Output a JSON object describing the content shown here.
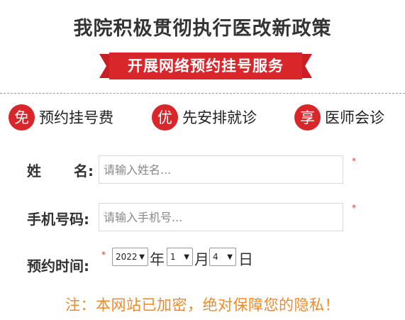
{
  "header": {
    "title": "我院积极贯彻执行医改新政策",
    "ribbon_text": "开展网络预约挂号服务",
    "ribbon_color": "#d8262b"
  },
  "features": [
    {
      "badge": "免",
      "label": "预约挂号费"
    },
    {
      "badge": "优",
      "label": "先安排就诊"
    },
    {
      "badge": "享",
      "label": "医师会诊"
    }
  ],
  "form": {
    "name_label_1": "姓",
    "name_label_2": "名:",
    "name_placeholder": "请输入姓名...",
    "phone_label": "手机号码:",
    "phone_placeholder": "请输入手机号...",
    "date_label": "预约时间:",
    "required_mark": "*",
    "year_value": "2022",
    "year_unit": "年",
    "month_value": "1",
    "month_unit": "月",
    "day_value": "4",
    "day_unit": "日"
  },
  "notice": "注：本网站已加密，绝对保障您的隐私！"
}
